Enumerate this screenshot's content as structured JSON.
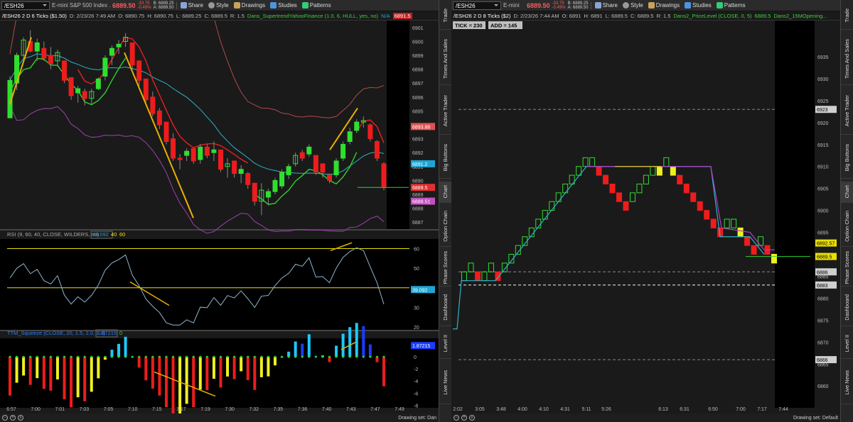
{
  "left": {
    "symbol": "/ESH26",
    "description": "E-mini S&P 500 Index ...",
    "last": "6889.50",
    "change": "-33.75",
    "change_pct": "-0.49%",
    "bid": "B: 6889.25",
    "ask": "A: 6889.50",
    "buttons": [
      "Share",
      "Style",
      "Drawings",
      "Studies",
      "Patterns"
    ],
    "info": {
      "title": "/ESH26 2 D 6 Ticks ($1.50)",
      "date": "D: 2/23/26 7:49 AM",
      "open": "O: 6890.75",
      "high": "H: 6890.75",
      "low": "L: 6889.25",
      "close": "C: 6889.5",
      "range": "R: 1.5",
      "study": "Dans_SupertrendYahooFinance (1.0, 6, HULL, yes, no)",
      "na": "N/A",
      "value": "6891.5"
    },
    "price_axis": [
      "6901",
      "6900",
      "6899",
      "6898",
      "6897",
      "6896",
      "6895",
      "6894",
      "6893",
      "6892",
      "6891",
      "6890",
      "6889",
      "6888",
      "6887"
    ],
    "price_labels": [
      {
        "text": "6893.88",
        "color": "#e05050"
      },
      {
        "text": "6891.2",
        "color": "#1ea5d2"
      },
      {
        "text": "6889.5",
        "color": "#e03030"
      },
      {
        "text": "6888.51",
        "color": "#c050c0"
      }
    ],
    "rsi": {
      "title": "RSI (9, 60, 40, CLOSE, WILDERS, no)",
      "value": "39.092",
      "ob": "40",
      "os": "60",
      "axis": [
        "60",
        "50",
        "40",
        "30",
        "20"
      ],
      "label": "39.092"
    },
    "ttm": {
      "title": "TTM_Squeeze (CLOSE, 20, 1.5, 2.0, 1.0)",
      "value": "1.87215",
      "extra": "0",
      "axis": [
        "2",
        "0",
        "-2",
        "-4",
        "-6",
        "-8"
      ],
      "label": "1.87215"
    },
    "time_axis": [
      "6:57",
      "7:00",
      "7:01",
      "7:03",
      "7:05",
      "7:10",
      "7:15",
      "7:17",
      "7:19",
      "7:30",
      "7:32",
      "7:35",
      "7:36",
      "7:40",
      "7:43",
      "7:47",
      "7:49"
    ],
    "footer_right": "Drawing set: Dan"
  },
  "right": {
    "symbol": "/ESH26",
    "description": "E-mini",
    "last": "6889.50",
    "change": "-33.75",
    "change_pct": "-0.49%",
    "bid": "B: 6889.25",
    "ask": "A: 6889.50",
    "buttons": [
      "Share",
      "Style",
      "Drawings",
      "Studies",
      "Patterns"
    ],
    "info": {
      "title": "/ESH26 2 D 8 Ticks ($2)",
      "date": "D: 2/23/26 7:44 AM",
      "open": "O: 6891",
      "high": "H: 6891",
      "low": "L: 6889.5",
      "close": "C: 6889.5",
      "range": "R: 1.5",
      "study": "Dans2_PriceLevel (CLOSE, 0, 5)",
      "value": "6889.5",
      "study2": "Dans2_15MOpening..."
    },
    "tick": "TICK = 230",
    "add": "ADD = 145",
    "price_axis": [
      "6935",
      "6930",
      "6925",
      "6920",
      "6915",
      "6910",
      "6905",
      "6900",
      "6895",
      "6890",
      "6885",
      "6880",
      "6875",
      "6870",
      "6865",
      "6860"
    ],
    "price_labels": [
      {
        "text": "6923",
        "color": "#cfcfcf"
      },
      {
        "text": "6892.57",
        "color": "#e8e000"
      },
      {
        "text": "6889.5",
        "color": "#e8e000"
      },
      {
        "text": "6886",
        "color": "#cfcfcf"
      },
      {
        "text": "6883",
        "color": "#cfcfcf"
      },
      {
        "text": "6866",
        "color": "#cfcfcf"
      }
    ],
    "time_axis": [
      "2:02",
      "3:05",
      "3:48",
      "4:00",
      "4:10",
      "4:31",
      "5:11",
      "5:26",
      "6:13",
      "6:31",
      "6:50",
      "7:00",
      "7:17",
      "7:44"
    ],
    "footer_right": "Drawing set: Default"
  },
  "sidebar_left": [
    "Trade",
    "Times And Sales",
    "Active Trader",
    "Big Buttons",
    "Chart",
    "Option Chain",
    "Phase Scores",
    "Dashboard",
    "Level II",
    "Live News"
  ],
  "sidebar_right": [
    "Trade",
    "Times And Sales",
    "Active Trader",
    "Big Buttons",
    "Chart",
    "Option Chain",
    "Phase Scores",
    "Dashboard",
    "Level II",
    "Live News"
  ],
  "chart_data": [
    {
      "type": "candlestick",
      "name": "/ESH26 2 D 6 Ticks",
      "ylim": [
        6886.5,
        6901.5
      ],
      "xlabels": [
        "6:57",
        "7:00",
        "7:01",
        "7:03",
        "7:05",
        "7:10",
        "7:15",
        "7:17",
        "7:19",
        "7:30",
        "7:32",
        "7:35",
        "7:36",
        "7:40",
        "7:43",
        "7:47",
        "7:49"
      ],
      "candles": [
        [
          6894.5,
          6897.5,
          6894.5,
          6897.2
        ],
        [
          6897.0,
          6899.2,
          6896.5,
          6899.0
        ],
        [
          6899.0,
          6900.3,
          6898.5,
          6900.1
        ],
        [
          6900.0,
          6900.8,
          6899.2,
          6899.3
        ],
        [
          6899.3,
          6900.2,
          6898.6,
          6899.9
        ],
        [
          6899.5,
          6900.0,
          6898.6,
          6898.8
        ],
        [
          6899.0,
          6899.6,
          6898.0,
          6898.4
        ],
        [
          6898.6,
          6899.4,
          6898.2,
          6899.2
        ],
        [
          6898.6,
          6898.6,
          6897.0,
          6897.2
        ],
        [
          6897.4,
          6897.4,
          6895.8,
          6896.1
        ],
        [
          6896.3,
          6896.8,
          6895.6,
          6896.6
        ],
        [
          6896.4,
          6896.6,
          6895.4,
          6895.9
        ],
        [
          6895.9,
          6896.6,
          6895.5,
          6896.4
        ],
        [
          6896.6,
          6897.4,
          6896.5,
          6897.3
        ],
        [
          6897.5,
          6899.0,
          6897.2,
          6898.8
        ],
        [
          6899.0,
          6899.7,
          6898.3,
          6899.5
        ],
        [
          6899.6,
          6900.1,
          6899.1,
          6899.8
        ],
        [
          6900.0,
          6900.6,
          6899.6,
          6900.3
        ],
        [
          6899.9,
          6899.9,
          6898.0,
          6898.3
        ],
        [
          6898.6,
          6898.6,
          6896.8,
          6897.2
        ],
        [
          6897.3,
          6897.3,
          6895.6,
          6895.8
        ],
        [
          6896.0,
          6896.4,
          6894.6,
          6894.8
        ],
        [
          6895.0,
          6895.2,
          6893.7,
          6894.0
        ],
        [
          6894.2,
          6894.2,
          6892.6,
          6892.8
        ],
        [
          6893.0,
          6893.4,
          6891.4,
          6891.6
        ],
        [
          6891.6,
          6891.9,
          6890.8,
          6891.5
        ],
        [
          6891.8,
          6892.3,
          6891.4,
          6892.1
        ],
        [
          6892.3,
          6892.3,
          6891.2,
          6891.4
        ],
        [
          6891.5,
          6892.6,
          6891.2,
          6892.4
        ],
        [
          6892.4,
          6892.6,
          6891.6,
          6891.8
        ],
        [
          6892.0,
          6892.8,
          6891.4,
          6892.2
        ],
        [
          6892.2,
          6892.2,
          6890.6,
          6890.8
        ],
        [
          6891.0,
          6891.6,
          6890.2,
          6891.2
        ],
        [
          6891.4,
          6891.4,
          6890.2,
          6890.5
        ],
        [
          6890.5,
          6891.1,
          6889.8,
          6890.8
        ],
        [
          6890.5,
          6890.6,
          6889.4,
          6889.7
        ],
        [
          6889.8,
          6889.8,
          6888.2,
          6888.5
        ],
        [
          6888.5,
          6889.8,
          6887.5,
          6889.3
        ],
        [
          6888.8,
          6889.4,
          6888.2,
          6889.2
        ],
        [
          6889.2,
          6890.2,
          6889.0,
          6890.0
        ],
        [
          6889.6,
          6890.8,
          6889.4,
          6890.6
        ],
        [
          6890.4,
          6891.2,
          6890.1,
          6891.0
        ],
        [
          6891.2,
          6892.0,
          6891.0,
          6891.8
        ],
        [
          6892.0,
          6892.2,
          6891.4,
          6891.6
        ],
        [
          6891.9,
          6892.6,
          6891.7,
          6892.4
        ],
        [
          6891.8,
          6891.8,
          6890.4,
          6890.6
        ],
        [
          6891.2,
          6891.2,
          6890.2,
          6890.6
        ],
        [
          6890.4,
          6890.5,
          6889.8,
          6890.0
        ],
        [
          6890.4,
          6891.6,
          6890.2,
          6891.4
        ],
        [
          6891.6,
          6892.8,
          6891.4,
          6892.6
        ],
        [
          6892.8,
          6893.8,
          6892.6,
          6893.5
        ],
        [
          6893.6,
          6894.4,
          6893.4,
          6894.2
        ],
        [
          6894.2,
          6894.6,
          6893.8,
          6894.3
        ],
        [
          6894.0,
          6894.1,
          6892.8,
          6893.0
        ],
        [
          6892.8,
          6892.9,
          6891.4,
          6891.6
        ],
        [
          6891.2,
          6891.3,
          6889.3,
          6889.5
        ]
      ]
    },
    {
      "type": "renko",
      "name": "/ESH26 2 D 8 Ticks",
      "ylim": [
        6856,
        6940
      ],
      "xlabels": [
        "2:02",
        "3:05",
        "3:48",
        "4:00",
        "4:10",
        "4:31",
        "5:11",
        "5:26",
        "6:13",
        "6:31",
        "6:50",
        "7:00",
        "7:17",
        "7:44"
      ],
      "bricks": [
        [
          6884,
          6886,
          "up"
        ],
        [
          6886,
          6888,
          "up"
        ],
        [
          6884,
          6886,
          "down"
        ],
        [
          6884,
          6886,
          "up"
        ],
        [
          6886,
          6888,
          "up"
        ],
        [
          6884,
          6886,
          "down"
        ],
        [
          6886,
          6888,
          "up"
        ],
        [
          6888,
          6890,
          "up"
        ],
        [
          6890,
          6892,
          "up"
        ],
        [
          6892,
          6894,
          "up"
        ],
        [
          6894,
          6896,
          "up"
        ],
        [
          6896,
          6898,
          "up"
        ],
        [
          6898,
          6900,
          "up"
        ],
        [
          6900,
          6902,
          "up"
        ],
        [
          6902,
          6904,
          "up"
        ],
        [
          6904,
          6906,
          "up"
        ],
        [
          6906,
          6908,
          "up"
        ],
        [
          6908,
          6910,
          "up"
        ],
        [
          6910,
          6912,
          "up"
        ],
        [
          6910,
          6912,
          "up"
        ],
        [
          6908,
          6910,
          "down"
        ],
        [
          6906,
          6908,
          "down"
        ],
        [
          6904,
          6906,
          "down"
        ],
        [
          6902,
          6904,
          "down"
        ],
        [
          6900,
          6902,
          "down"
        ],
        [
          6902,
          6904,
          "up"
        ],
        [
          6904,
          6906,
          "up"
        ],
        [
          6906,
          6908,
          "up"
        ],
        [
          6908,
          6910,
          "up"
        ],
        [
          6908,
          6910,
          "neutral"
        ],
        [
          6910,
          6912,
          "up"
        ],
        [
          6908,
          6910,
          "neutral"
        ],
        [
          6906,
          6908,
          "down"
        ],
        [
          6904,
          6906,
          "down"
        ],
        [
          6902,
          6904,
          "down"
        ],
        [
          6900,
          6902,
          "down"
        ],
        [
          6898,
          6900,
          "down"
        ],
        [
          6896,
          6898,
          "down"
        ],
        [
          6894,
          6896,
          "down"
        ],
        [
          6896,
          6898,
          "up"
        ],
        [
          6896,
          6898,
          "up"
        ],
        [
          6894,
          6896,
          "neutral"
        ],
        [
          6892,
          6894,
          "down"
        ],
        [
          6890,
          6892,
          "down"
        ],
        [
          6892,
          6894,
          "up"
        ],
        [
          6890,
          6892,
          "down"
        ],
        [
          6888,
          6890,
          "neutral"
        ]
      ]
    }
  ]
}
